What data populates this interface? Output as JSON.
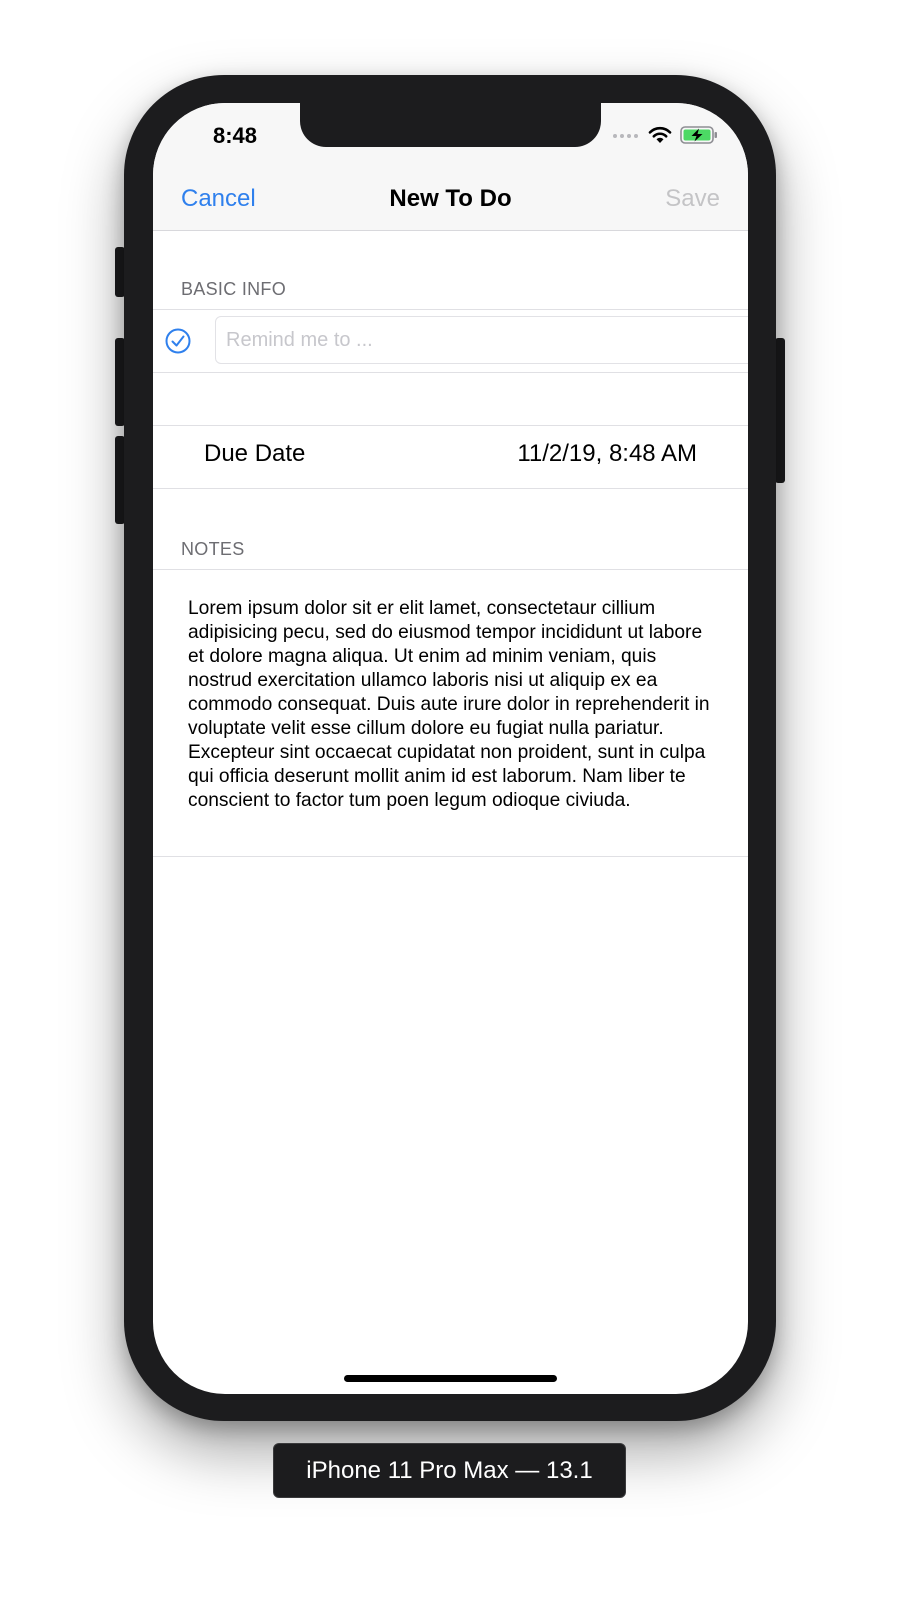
{
  "status_bar": {
    "time": "8:48"
  },
  "nav": {
    "cancel_label": "Cancel",
    "title": "New To Do",
    "save_label": "Save"
  },
  "basic_info": {
    "header": "BASIC INFO",
    "remind_placeholder": "Remind me to ...",
    "remind_value": ""
  },
  "due_date": {
    "label": "Due Date",
    "value": "11/2/19, 8:48 AM"
  },
  "notes": {
    "header": "NOTES",
    "text": "Lorem ipsum dolor sit er elit lamet, consectetaur cillium adipisicing pecu, sed do eiusmod tempor incididunt ut labore et dolore magna aliqua. Ut enim ad minim veniam, quis nostrud exercitation ullamco laboris nisi ut aliquip ex ea commodo consequat. Duis aute irure dolor in reprehenderit in voluptate velit esse cillum dolore eu fugiat nulla pariatur. Excepteur sint occaecat cupidatat non proident, sunt in culpa qui officia deserunt mollit anim id est laborum. Nam liber te conscient to factor tum poen legum odioque civiuda."
  },
  "device": {
    "label": "iPhone 11 Pro Max — 13.1"
  },
  "icons": [
    "signal-icon",
    "wifi-icon",
    "battery-charging-icon",
    "checkmark-circle-icon"
  ],
  "colors": {
    "accent": "#2f80ed",
    "disabled": "#c4c4c6",
    "battery": "#4cd964"
  }
}
